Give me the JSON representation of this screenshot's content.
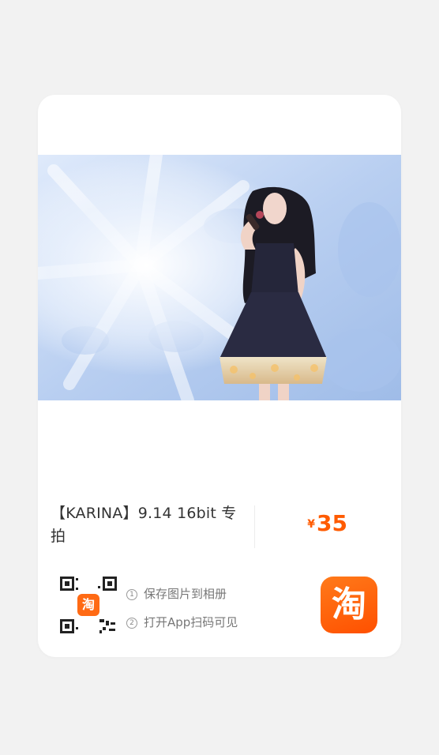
{
  "product": {
    "title": "【KARINA】9.14 16bit 专拍",
    "currency": "¥",
    "price": "35"
  },
  "qr": {
    "logo_text": "淘"
  },
  "steps": [
    {
      "num": "1",
      "text": "保存图片到相册"
    },
    {
      "num": "2",
      "text": "打开App扫码可见"
    }
  ],
  "app_icon": {
    "text": "淘",
    "color": "#ff5000"
  },
  "colors": {
    "price": "#ff5b00",
    "background": "#f2f2f2",
    "card": "#ffffff"
  }
}
